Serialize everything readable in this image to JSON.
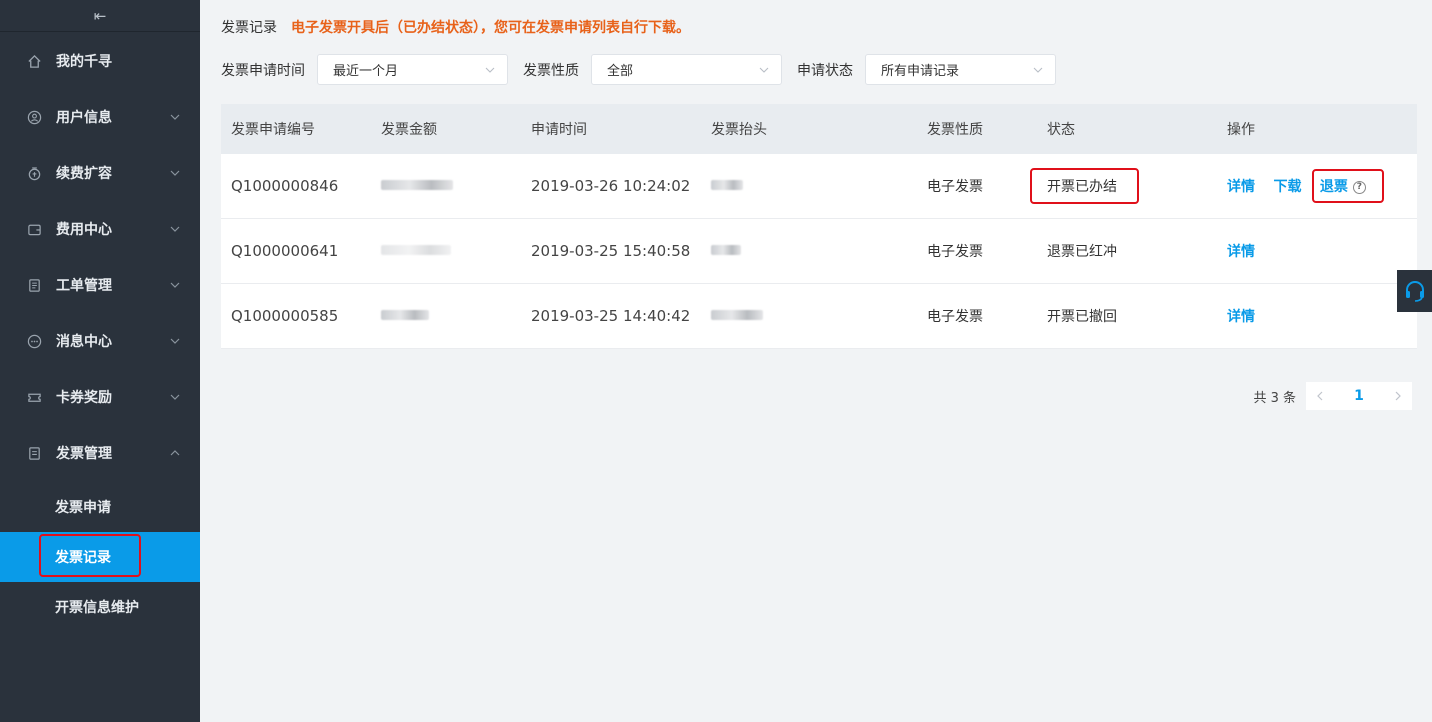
{
  "sidebar": {
    "collapse_glyph": "⇤",
    "items": [
      {
        "label": "我的千寻",
        "icon": "home-icon"
      },
      {
        "label": "用户信息",
        "icon": "user-icon"
      },
      {
        "label": "续费扩容",
        "icon": "wallet-icon"
      },
      {
        "label": "费用中心",
        "icon": "purse-icon"
      },
      {
        "label": "工单管理",
        "icon": "document-icon"
      },
      {
        "label": "消息中心",
        "icon": "message-icon"
      },
      {
        "label": "卡券奖励",
        "icon": "ticket-icon"
      },
      {
        "label": "发票管理",
        "icon": "invoice-icon"
      }
    ],
    "sub_items": [
      {
        "label": "发票申请"
      },
      {
        "label": "发票记录"
      },
      {
        "label": "开票信息维护"
      }
    ],
    "active_color": "#0a9be8"
  },
  "notice": {
    "label": "发票记录",
    "tip": "电子发票开具后（已办结状态），您可在发票申请列表自行下载。"
  },
  "filters": {
    "time_label": "发票申请时间",
    "time_value": "最近一个月",
    "nature_label": "发票性质",
    "nature_value": "全部",
    "status_label": "申请状态",
    "status_value": "所有申请记录"
  },
  "table": {
    "headers": [
      "发票申请编号",
      "发票金额",
      "申请时间",
      "发票抬头",
      "发票性质",
      "状态",
      "操作"
    ],
    "rows": [
      {
        "id": "Q1000000846",
        "time": "2019-03-26 10:24:02",
        "nature": "电子发票",
        "status": "开票已办结",
        "actions": [
          "详情",
          "下载",
          "退票"
        ]
      },
      {
        "id": "Q1000000641",
        "time": "2019-03-25 15:40:58",
        "nature": "电子发票",
        "status": "退票已红冲",
        "actions": [
          "详情"
        ]
      },
      {
        "id": "Q1000000585",
        "time": "2019-03-25 14:40:42",
        "nature": "电子发票",
        "status": "开票已撤回",
        "actions": [
          "详情"
        ]
      }
    ]
  },
  "pagination": {
    "total": "共 3 条",
    "current": "1"
  },
  "colors": {
    "sidebar_bg": "#2a323c",
    "accent": "#0a9be8",
    "tip": "#e8621a",
    "highlight_border": "#e0101a"
  }
}
